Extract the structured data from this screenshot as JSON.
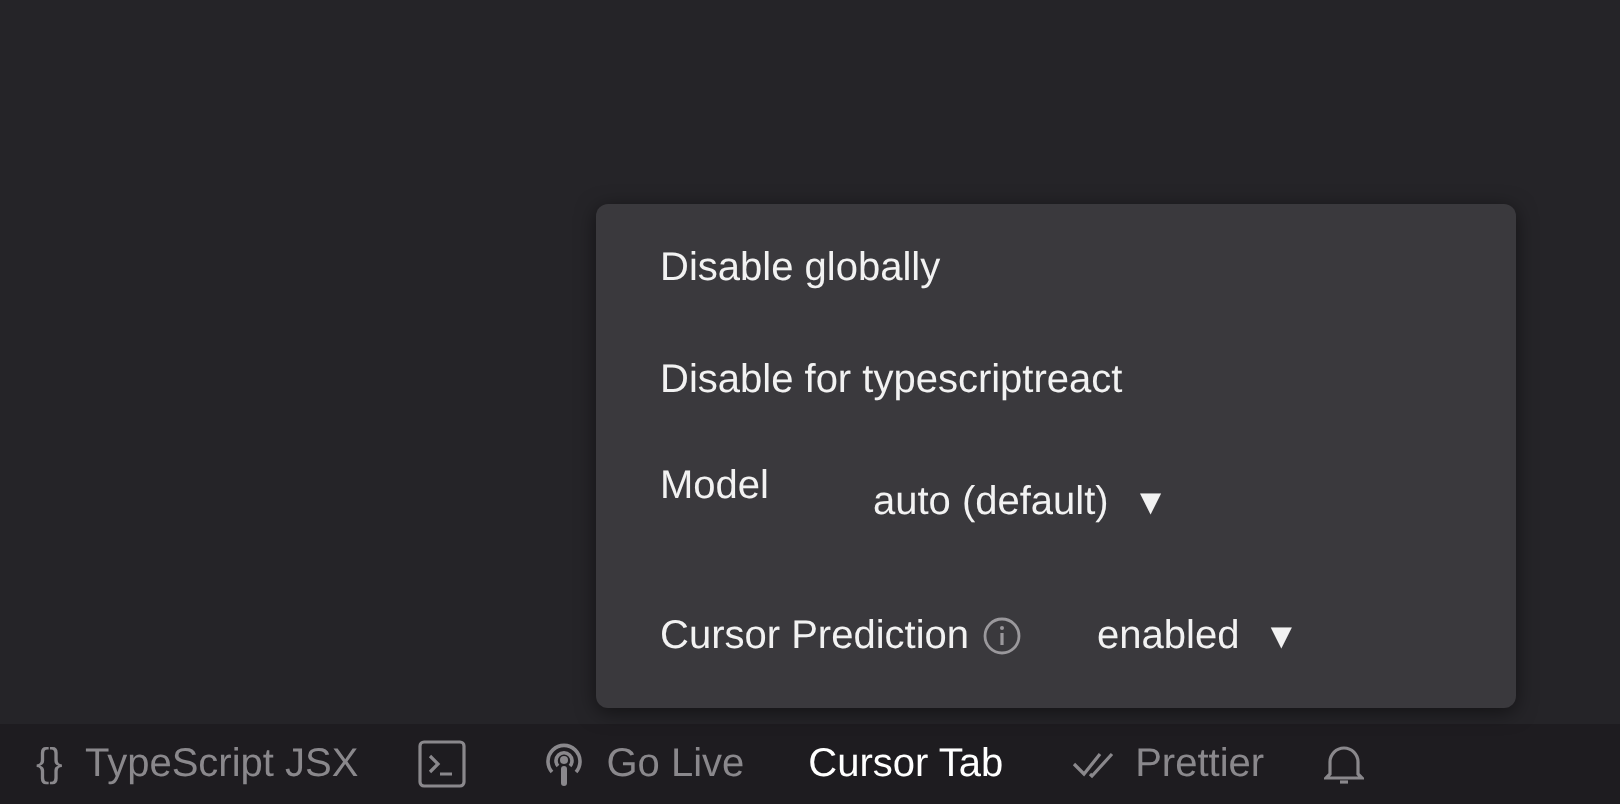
{
  "menu": {
    "items": [
      {
        "kind": "action",
        "label": "Disable globally"
      },
      {
        "kind": "action",
        "label": "Disable for typescriptreact"
      },
      {
        "kind": "select",
        "label": "Model",
        "value": "auto (default)",
        "caret": "▼",
        "info": false
      },
      {
        "kind": "select",
        "label": "Cursor Prediction",
        "value": "enabled",
        "caret": "▼",
        "info": true
      }
    ]
  },
  "status_bar": {
    "items": [
      {
        "kind": "language",
        "glyph": "{}",
        "label": "TypeScript JSX",
        "selected": false
      },
      {
        "kind": "terminal",
        "selected": false
      },
      {
        "kind": "live",
        "label": "Go Live",
        "selected": false
      },
      {
        "kind": "text",
        "label": "Cursor Tab",
        "selected": true
      },
      {
        "kind": "prettier",
        "label": "Prettier",
        "selected": false
      },
      {
        "kind": "bell",
        "selected": false
      }
    ]
  }
}
